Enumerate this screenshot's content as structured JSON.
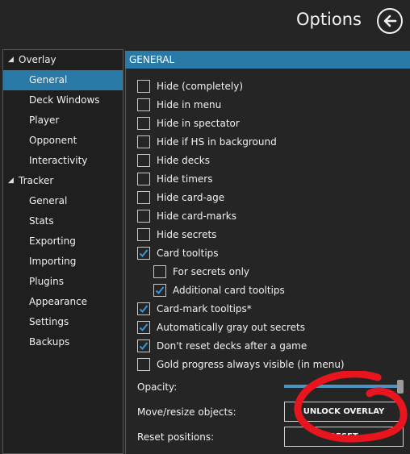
{
  "header": {
    "title": "Options",
    "back_icon": "arrow-left-icon"
  },
  "sidebar": {
    "groups": [
      {
        "label": "Overlay",
        "items": [
          "General",
          "Deck Windows",
          "Player",
          "Opponent",
          "Interactivity"
        ]
      },
      {
        "label": "Tracker",
        "items": [
          "General",
          "Stats",
          "Exporting",
          "Importing",
          "Plugins",
          "Appearance",
          "Settings",
          "Backups"
        ]
      }
    ],
    "selected": "Overlay/General"
  },
  "section": {
    "title": "GENERAL"
  },
  "checkboxes": [
    {
      "label": "Hide (completely)",
      "checked": false
    },
    {
      "label": "Hide in menu",
      "checked": false
    },
    {
      "label": "Hide in spectator",
      "checked": false
    },
    {
      "label": "Hide if HS in background",
      "checked": false
    },
    {
      "label": "Hide decks",
      "checked": false
    },
    {
      "label": "Hide timers",
      "checked": false
    },
    {
      "label": "Hide card-age",
      "checked": false
    },
    {
      "label": "Hide card-marks",
      "checked": false
    },
    {
      "label": "Hide secrets",
      "checked": false
    },
    {
      "label": "Card tooltips",
      "checked": true
    },
    {
      "label": "For secrets only",
      "checked": false
    },
    {
      "label": "Additional card tooltips",
      "checked": true
    },
    {
      "label": "Card-mark tooltips*",
      "checked": true
    },
    {
      "label": "Automatically gray out secrets",
      "checked": true
    },
    {
      "label": "Don't reset decks after a game",
      "checked": true
    },
    {
      "label": "Gold progress always visible (in menu)",
      "checked": false
    }
  ],
  "settings": {
    "opacity_label": "Opacity:",
    "opacity_value": 1.0,
    "move_label": "Move/resize objects:",
    "unlock_button": "UNLOCK OVERLAY",
    "reset_label": "Reset positions:",
    "reset_button": "RESET"
  },
  "colors": {
    "accent": "#2a7aa8",
    "annotation": "#e8141e",
    "background": "#252526"
  }
}
